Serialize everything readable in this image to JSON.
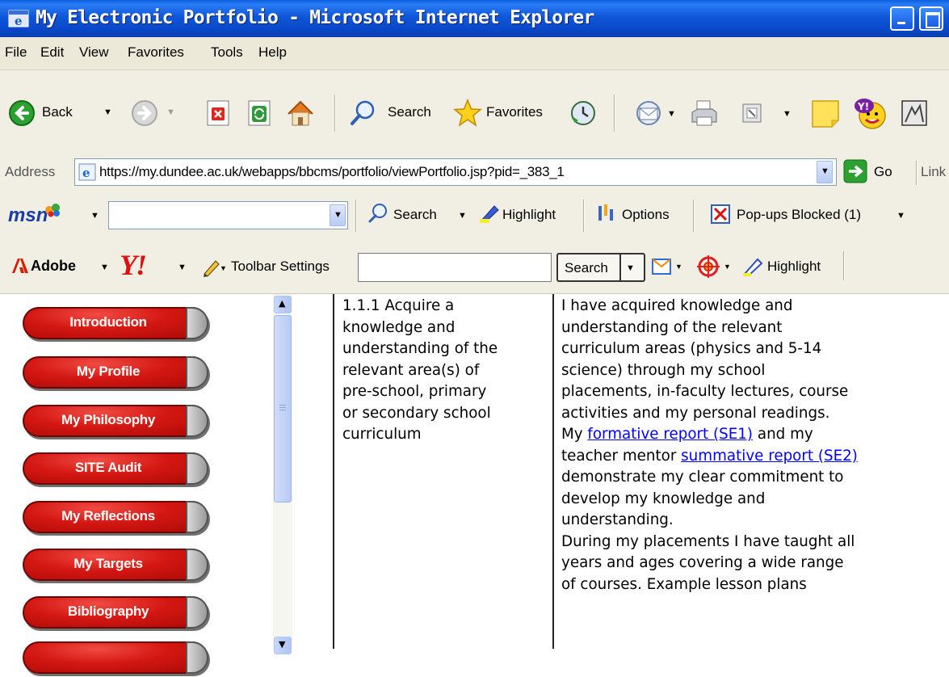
{
  "window": {
    "title": "My Electronic Portfolio - Microsoft Internet Explorer"
  },
  "menu": [
    "File",
    "Edit",
    "View",
    "Favorites",
    "Tools",
    "Help"
  ],
  "toolbar": {
    "back": "Back",
    "search": "Search",
    "favorites": "Favorites"
  },
  "address": {
    "label": "Address",
    "url": "https://my.dundee.ac.uk/webapps/bbcms/portfolio/viewPortfolio.jsp?pid=_383_1",
    "go": "Go",
    "links": "Link"
  },
  "msn": {
    "logo": "msn",
    "search": "Search",
    "highlight": "Highlight",
    "options": "Options",
    "popups": "Pop-ups Blocked (1)"
  },
  "yahoo": {
    "adobe": "Adobe",
    "settings": "Toolbar Settings",
    "search": "Search",
    "highlight": "Highlight"
  },
  "nav": [
    "Introduction",
    "My Profile",
    "My Philosophy",
    "SITE Audit",
    "My Reflections",
    "My Targets",
    "Bibliography"
  ],
  "standard": [
    "1.1.1 Acquire a",
    "knowledge and",
    "understanding of the",
    "relevant area(s) of",
    "pre-school, primary",
    "or secondary school",
    "curriculum"
  ],
  "evidence": {
    "l1": "I have acquired knowledge and",
    "l2": "understanding of the relevant",
    "l3": "curriculum areas (physics and 5-14",
    "l4": "science) through my school",
    "l5": "placements, in-faculty lectures, course",
    "l6": "activities and my personal readings.",
    "l7a": "My ",
    "link1": "formative report (SE1)",
    "l7b": " and my",
    "l8a": "teacher mentor ",
    "link2": "summative report (SE2)",
    "l9": "demonstrate my clear commitment to",
    "l10": "develop my knowledge and",
    "l11": "understanding.",
    "l12": "During my placements I have taught all",
    "l13": "years and ages covering a wide range",
    "l14": "of courses.  Example lesson plans"
  }
}
